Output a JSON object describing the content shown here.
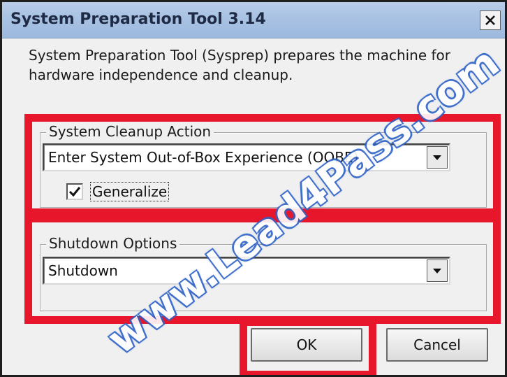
{
  "window": {
    "title": "System Preparation Tool 3.14",
    "close_label": "X"
  },
  "description": "System Preparation Tool (Sysprep) prepares the machine for hardware independence and cleanup.",
  "cleanup": {
    "group_label": "System Cleanup Action",
    "selected_action": "Enter System Out-of-Box Experience (OOBE)",
    "generalize_label": "Generalize",
    "generalize_checked": true
  },
  "shutdown": {
    "group_label": "Shutdown Options",
    "selected_option": "Shutdown"
  },
  "buttons": {
    "ok": "OK",
    "cancel": "Cancel"
  },
  "watermark": "www.Lead4Pass.com",
  "colors": {
    "highlight_red": "#e8162b",
    "watermark_blue": "#2f63c7",
    "title_bar": "#a9c2e3"
  }
}
